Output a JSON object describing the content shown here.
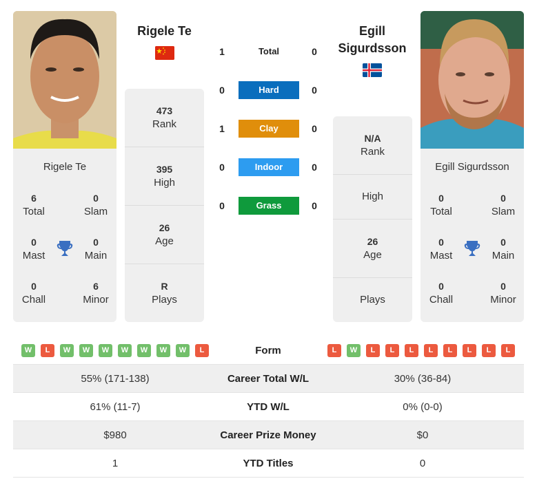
{
  "player1": {
    "name": "Rigele Te",
    "country_flag": "china-flag",
    "photo": "player-photo",
    "titles": {
      "total": {
        "value": "6",
        "label": "Total"
      },
      "slam": {
        "value": "0",
        "label": "Slam"
      },
      "mast": {
        "value": "0",
        "label": "Mast"
      },
      "main": {
        "value": "0",
        "label": "Main"
      },
      "chall": {
        "value": "0",
        "label": "Chall"
      },
      "minor": {
        "value": "6",
        "label": "Minor"
      }
    },
    "stats": [
      {
        "value": "473",
        "label": "Rank"
      },
      {
        "value": "395",
        "label": "High"
      },
      {
        "value": "26",
        "label": "Age"
      },
      {
        "value": "R",
        "label": "Plays"
      }
    ],
    "form": [
      "W",
      "L",
      "W",
      "W",
      "W",
      "W",
      "W",
      "W",
      "W",
      "L"
    ]
  },
  "player2": {
    "name": "Egill Sigurdsson",
    "name_line1": "Egill",
    "name_line2": "Sigurdsson",
    "country_flag": "iceland-flag",
    "photo": "player-photo",
    "titles": {
      "total": {
        "value": "0",
        "label": "Total"
      },
      "slam": {
        "value": "0",
        "label": "Slam"
      },
      "mast": {
        "value": "0",
        "label": "Mast"
      },
      "main": {
        "value": "0",
        "label": "Main"
      },
      "chall": {
        "value": "0",
        "label": "Chall"
      },
      "minor": {
        "value": "0",
        "label": "Minor"
      }
    },
    "stats": [
      {
        "value": "N/A",
        "label": "Rank"
      },
      {
        "value": "",
        "label": "High"
      },
      {
        "value": "26",
        "label": "Age"
      },
      {
        "value": "",
        "label": "Plays"
      }
    ],
    "form": [
      "L",
      "W",
      "L",
      "L",
      "L",
      "L",
      "L",
      "L",
      "L",
      "L"
    ]
  },
  "h2h": [
    {
      "label": "Total",
      "p1": "1",
      "p2": "0",
      "color": ""
    },
    {
      "label": "Hard",
      "p1": "0",
      "p2": "0",
      "color": "#0a6ebd"
    },
    {
      "label": "Clay",
      "p1": "1",
      "p2": "0",
      "color": "#e08e0b"
    },
    {
      "label": "Indoor",
      "p1": "0",
      "p2": "0",
      "color": "#2d9cf0"
    },
    {
      "label": "Grass",
      "p1": "0",
      "p2": "0",
      "color": "#0f9a3c"
    }
  ],
  "form_label": "Form",
  "comparison": [
    {
      "p1": "55% (171-138)",
      "label": "Career Total W/L",
      "p2": "30% (36-84)"
    },
    {
      "p1": "61% (11-7)",
      "label": "YTD W/L",
      "p2": "0% (0-0)"
    },
    {
      "p1": "$980",
      "label": "Career Prize Money",
      "p2": "$0"
    },
    {
      "p1": "1",
      "label": "YTD Titles",
      "p2": "0"
    }
  ],
  "colors": {
    "win": "#72bf6a",
    "loss": "#ec5a3f",
    "trophy": "#3a6fc1",
    "panel": "#efefef"
  }
}
